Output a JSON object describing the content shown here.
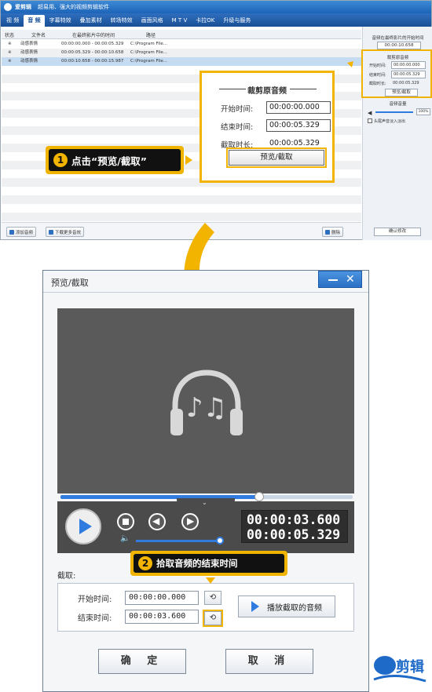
{
  "app": {
    "name": "爱剪辑",
    "slogan": "超易用、强大的视频剪辑软件",
    "tabs": [
      "视 频",
      "音 频",
      "字幕特效",
      "叠加素材",
      "转场特效",
      "画面风格",
      "M T V",
      "卡拉OK",
      "升级与服务"
    ],
    "active_tab": "音 频",
    "list_headers": {
      "status": "状态",
      "filename": "文件名",
      "time": "在最终影片中的时间",
      "path": "路径"
    },
    "rows": [
      {
        "status": "※",
        "name": "动感表情",
        "time": "00:00:00.000 - 00:00:05.329",
        "path": "C:\\Program File..."
      },
      {
        "status": "※",
        "name": "动感表情",
        "time": "00:00:05.329 - 00:00:10.658",
        "path": "C:\\Program File..."
      },
      {
        "status": "※",
        "name": "动感表情",
        "time": "00:00:10.658 - 00:00:15.987",
        "path": "C:\\Program File..."
      }
    ],
    "bottom": {
      "add_audio": "添加音频",
      "download_more": "下载更多音效",
      "delete": "删除",
      "confirm": "确认修改"
    },
    "right_panel": {
      "start_in_film_label": "音频在最终影片的开始时间",
      "start_in_film_value": "00:00:10.658",
      "trim_title": "裁剪原音频",
      "start_label": "开始时间:",
      "start_value": "00:00:00.000",
      "end_label": "结束时间:",
      "end_value": "00:00:05.329",
      "dur_label": "截取时长:",
      "dur_value": "00:00:05.329",
      "preview_btn": "预览/截取",
      "volume_title": "音频音量",
      "volume_value": "100%",
      "fade_label": "头尾声音淡入淡出"
    }
  },
  "callout": {
    "title": "裁剪原音频",
    "start_label": "开始时间:",
    "start_value": "00:00:00.000",
    "end_label": "结束时间:",
    "end_value": "00:00:05.329",
    "dur_label": "截取时长:",
    "dur_value": "00:00:05.329",
    "button": "预览/截取"
  },
  "step1": {
    "num": "1",
    "text": "点击“预览/截取”"
  },
  "dialog": {
    "title": "预览/截取",
    "progress": 0.68,
    "volume": 1.0,
    "time_current": "00:00:03.600",
    "time_total": "00:00:05.329",
    "cut_label": "截取:",
    "start_label": "开始时间:",
    "start_value": "00:00:00.000",
    "end_label": "结束时间:",
    "end_value": "00:00:03.600",
    "play_cut": "播放截取的音频",
    "ok": "确 定",
    "cancel": "取 消"
  },
  "step2": {
    "num": "2",
    "text": "拾取音频的结束时间"
  },
  "brand": {
    "text": "剪辑"
  },
  "colors": {
    "accent": "#f3b400",
    "blue": "#2f7be0"
  }
}
